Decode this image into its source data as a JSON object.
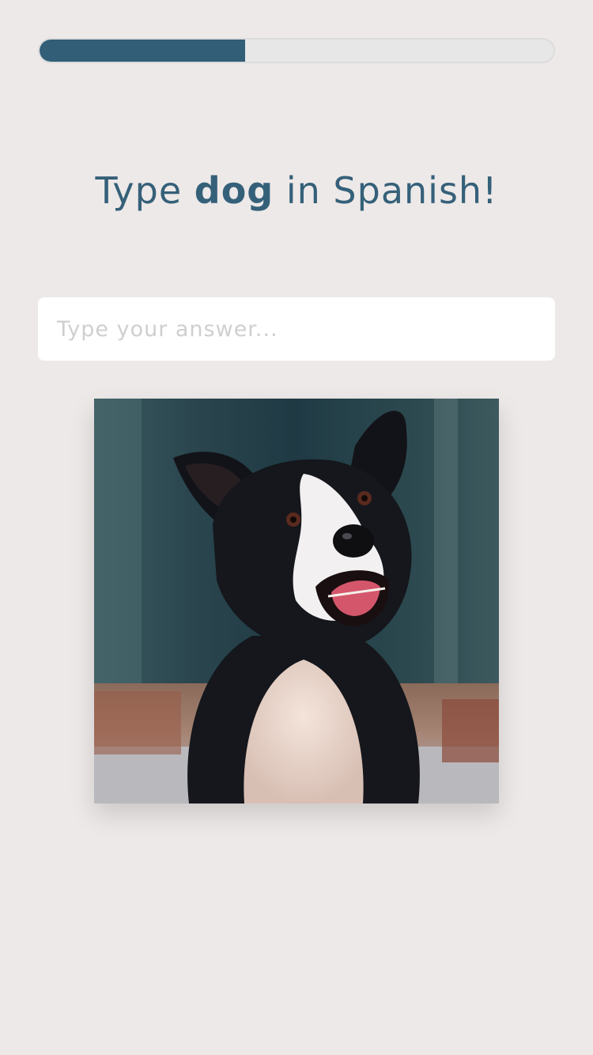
{
  "progress": {
    "value": 0.4,
    "fill_color": "#325e78"
  },
  "question": {
    "prefix": "Type",
    "word": "dog",
    "suffix": "in Spanish!"
  },
  "answer": {
    "placeholder": "Type your answer...",
    "value": ""
  },
  "image": {
    "subject": "dog-photo"
  }
}
